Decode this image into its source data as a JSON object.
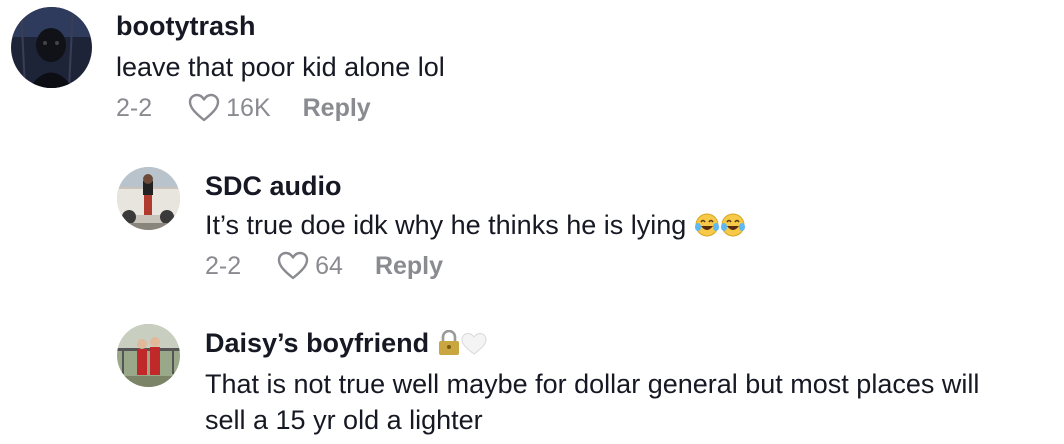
{
  "comments": [
    {
      "username": "bootytrash",
      "text": "leave that poor kid alone lol",
      "date": "2-2",
      "likes": "16K",
      "reply_label": "Reply"
    },
    {
      "username": "SDC audio",
      "text": "It’s true doe idk why he thinks he is lying",
      "emoji": "😂😂",
      "date": "2-2",
      "likes": "64",
      "reply_label": "Reply"
    },
    {
      "username": "Daisy’s boyfriend",
      "username_emoji": "🔒🤍",
      "text_line1": "That is not true well maybe for dollar general but most places will",
      "text_line2": "sell a 15 yr old a lighter"
    }
  ],
  "icons": {
    "like": "heart-outline-icon",
    "lock": "lock-icon",
    "heart": "white-heart-icon",
    "laugh": "tears-of-joy-icon"
  },
  "colors": {
    "text": "#161823",
    "meta": "#8a8b91"
  }
}
